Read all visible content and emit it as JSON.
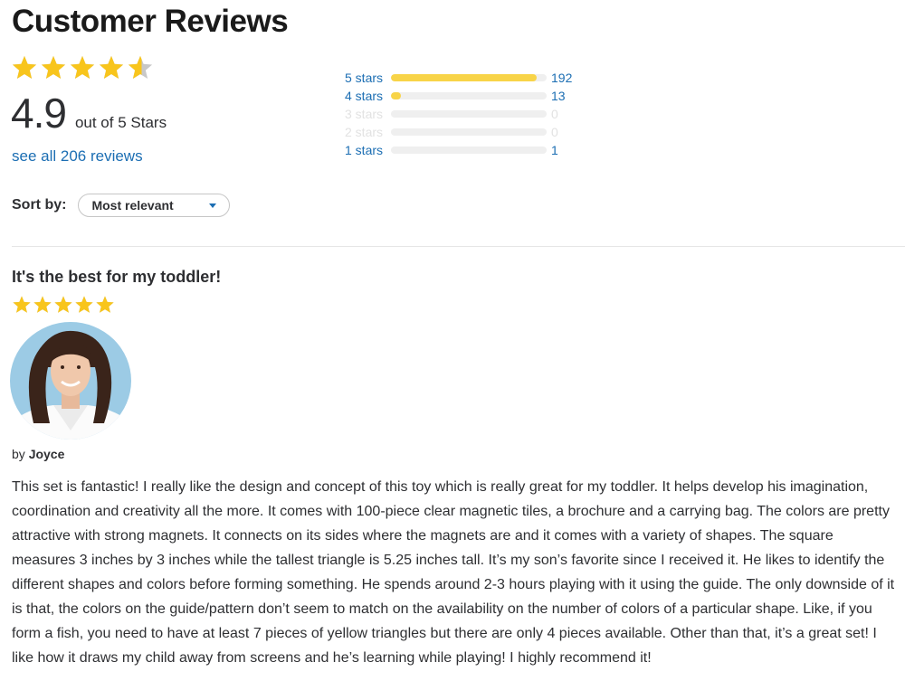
{
  "header": {
    "title": "Customer Reviews"
  },
  "summary": {
    "rating": 4.9,
    "rating_text": "4.9",
    "max_stars": 5,
    "out_of_text": "out of 5 Stars",
    "see_all_text": "see all 206 reviews",
    "star_color": "#f8c51c",
    "star_empty_color": "#c8c8c8"
  },
  "histogram": [
    {
      "label": "5 stars",
      "count": "192",
      "fraction": 0.937
    },
    {
      "label": "4 stars",
      "count": "13",
      "fraction": 0.063
    },
    {
      "label": "3 stars",
      "count": "0",
      "fraction": 0
    },
    {
      "label": "2 stars",
      "count": "0",
      "fraction": 0
    },
    {
      "label": "1 stars",
      "count": "1",
      "fraction": 0.005
    }
  ],
  "sort": {
    "label": "Sort by:",
    "selected": "Most relevant"
  },
  "review": {
    "title": "It's the best for my toddler!",
    "stars": 5,
    "by_prefix": "by",
    "author": "Joyce",
    "body": "This set is fantastic! I really like the design and concept of this toy which is really great for my toddler. It helps develop his imagination, coordination and creativity all the more. It comes with 100-piece clear magnetic tiles, a brochure and a carrying bag. The colors are pretty attractive with strong magnets. It connects on its sides where the magnets are and it comes with a variety of shapes. The square measures 3 inches by 3 inches while the tallest triangle is 5.25 inches tall. It’s my son’s favorite since I received it. He likes to identify the different shapes and colors before forming something. He spends around 2-3 hours playing with it using the guide. The only downside of it is that, the colors on the guide/pattern don’t seem to match on the availability on the number of colors of a particular shape. Like, if you form a fish, you need to have at least 7 pieces of yellow triangles but there are only 4 pieces available. Other than that, it’s a great set! I like how it draws my child away from screens and he’s learning while playing! I highly recommend it!"
  },
  "colors": {
    "link": "#1c6eb3",
    "bar_fill": "#f8d448",
    "bar_track": "#efefef",
    "muted": "#e2e2e2"
  }
}
